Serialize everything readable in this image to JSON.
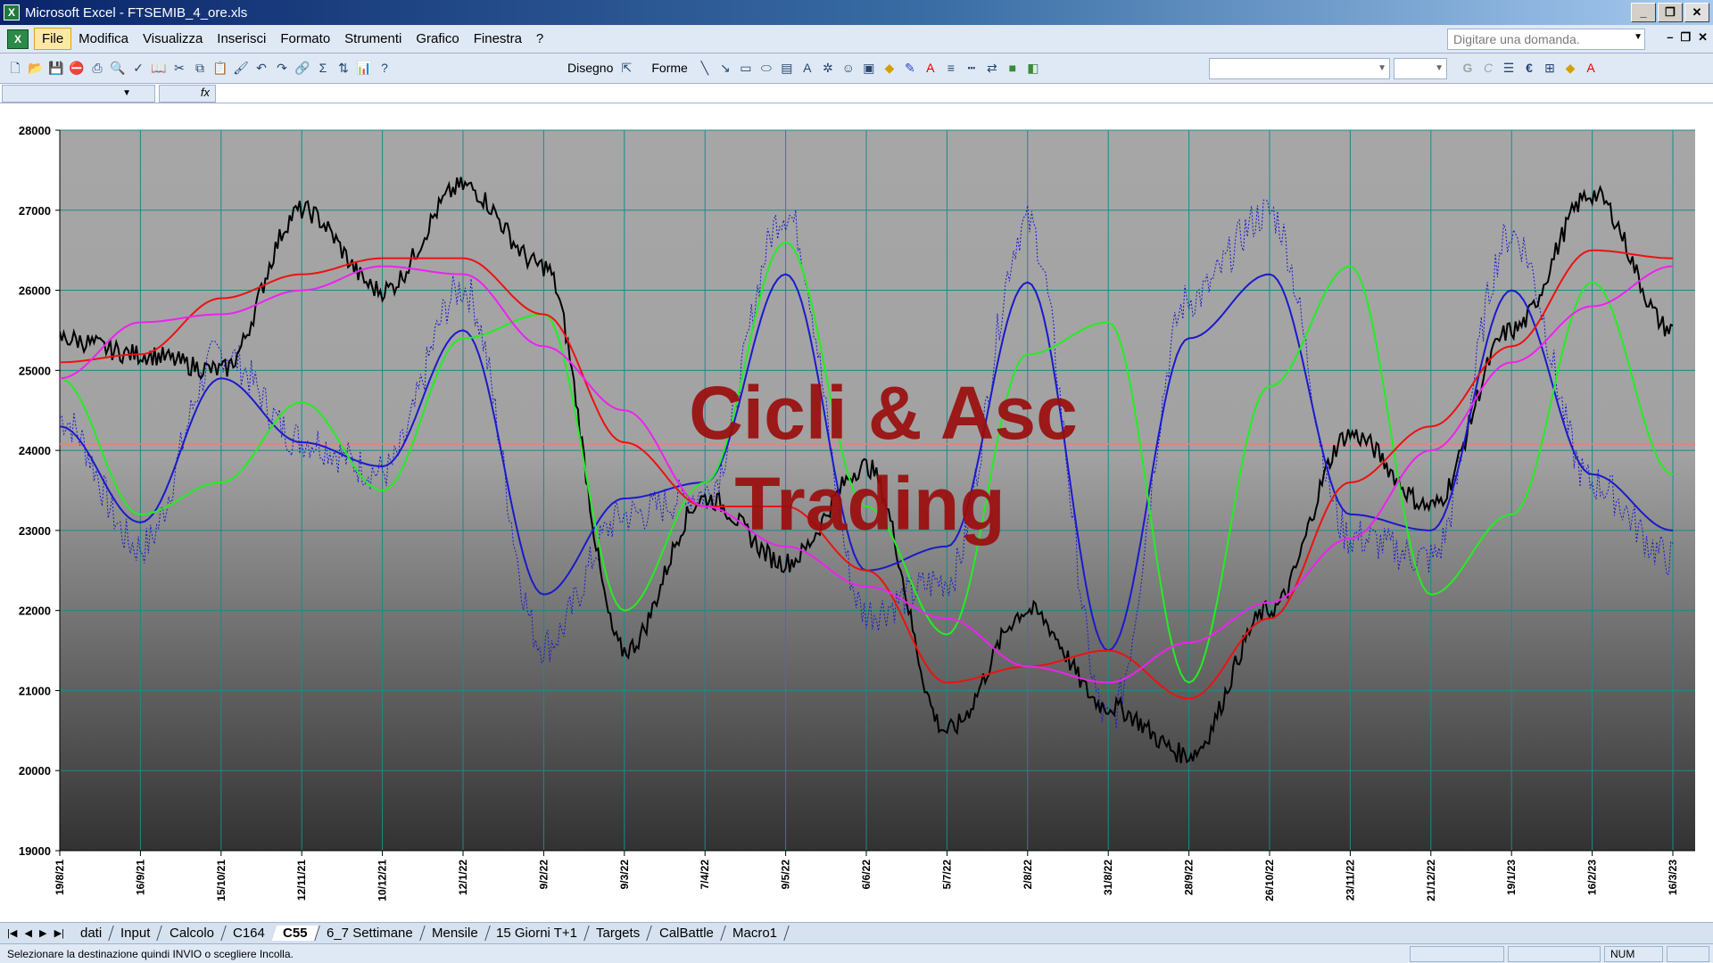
{
  "window": {
    "title": "Microsoft Excel - FTSEMIB_4_ore.xls",
    "app_icon": "excel-icon"
  },
  "menu": {
    "items": [
      "File",
      "Modifica",
      "Visualizza",
      "Inserisci",
      "Formato",
      "Strumenti",
      "Grafico",
      "Finestra",
      "?"
    ],
    "ask_placeholder": "Digitare una domanda."
  },
  "toolbar": {
    "disegno_label": "Disegno",
    "forme_label": "Forme",
    "bold_label": "G",
    "italic_label": "C",
    "euro_label": "€"
  },
  "chart": {
    "watermark_line1": "Cicli & Asc",
    "watermark_line2": "Trading",
    "y_ticks": [
      "28000",
      "27000",
      "26000",
      "25000",
      "24000",
      "23000",
      "22000",
      "21000",
      "20000",
      "19000"
    ],
    "x_ticks": [
      "19/8/21",
      "16/9/21",
      "15/10/21",
      "12/11/21",
      "10/12/21",
      "12/1/22",
      "9/2/22",
      "9/3/22",
      "7/4/22",
      "9/5/22",
      "6/6/22",
      "5/7/22",
      "2/8/22",
      "31/8/22",
      "28/9/22",
      "26/10/22",
      "23/11/22",
      "21/12/22",
      "19/1/23",
      "16/2/23",
      "16/3/23"
    ],
    "colors": {
      "price": "#000000",
      "dotted": "#1a1acc",
      "blue": "#1a1acc",
      "green": "#22ee22",
      "red": "#ee1111",
      "magenta": "#ee22ee",
      "hline": "#ff7777",
      "grid": "#1a8a8a"
    }
  },
  "chart_data": {
    "type": "line",
    "ylim": [
      19000,
      28000
    ],
    "x": [
      "19/8/21",
      "16/9/21",
      "15/10/21",
      "12/11/21",
      "10/12/21",
      "12/1/22",
      "9/2/22",
      "9/3/22",
      "7/4/22",
      "9/5/22",
      "6/6/22",
      "5/7/22",
      "2/8/22",
      "31/8/22",
      "28/9/22",
      "26/10/22",
      "23/11/22",
      "21/12/22",
      "19/1/23",
      "16/2/23",
      "16/3/23"
    ],
    "reference_line": 24080,
    "series": [
      {
        "values": [
          25400,
          25200,
          25000,
          27000,
          26000,
          27300,
          26300,
          21500,
          23400,
          22600,
          23800,
          20500,
          22000,
          20800,
          20200,
          22000,
          24200,
          23300,
          25500,
          27200,
          25500
        ]
      },
      {
        "values": [
          24300,
          23100,
          24900,
          24100,
          23800,
          25500,
          22200,
          23400,
          23600,
          26200,
          22500,
          22800,
          26100,
          21500,
          25400,
          26200,
          23200,
          23000,
          26000,
          23700,
          23000
        ]
      },
      {
        "values": [
          24900,
          23200,
          23600,
          24600,
          23500,
          25400,
          25700,
          22000,
          23600,
          26600,
          23300,
          21700,
          25200,
          25600,
          21100,
          24800,
          26300,
          22200,
          23200,
          26100,
          23700
        ]
      },
      {
        "values": [
          25100,
          25200,
          25900,
          26200,
          26400,
          26400,
          25700,
          24100,
          23300,
          23300,
          22500,
          21100,
          21300,
          21500,
          20900,
          21900,
          23600,
          24300,
          25300,
          26500,
          26400
        ]
      },
      {
        "values": [
          24900,
          25600,
          25700,
          26000,
          26300,
          26200,
          25300,
          24500,
          23300,
          22800,
          22300,
          21900,
          21300,
          21100,
          21600,
          22100,
          22900,
          24000,
          25100,
          25800,
          26300
        ]
      }
    ]
  },
  "tabs": {
    "items": [
      "dati",
      "Input",
      "Calcolo",
      "C164",
      "C55",
      "6_7 Settimane",
      "Mensile",
      "15 Giorni T+1",
      "Targets",
      "CalBattle",
      "Macro1"
    ],
    "active": "C55"
  },
  "status": {
    "message": "Selezionare la destinazione quindi INVIO o scegliere Incolla.",
    "num": "NUM"
  }
}
